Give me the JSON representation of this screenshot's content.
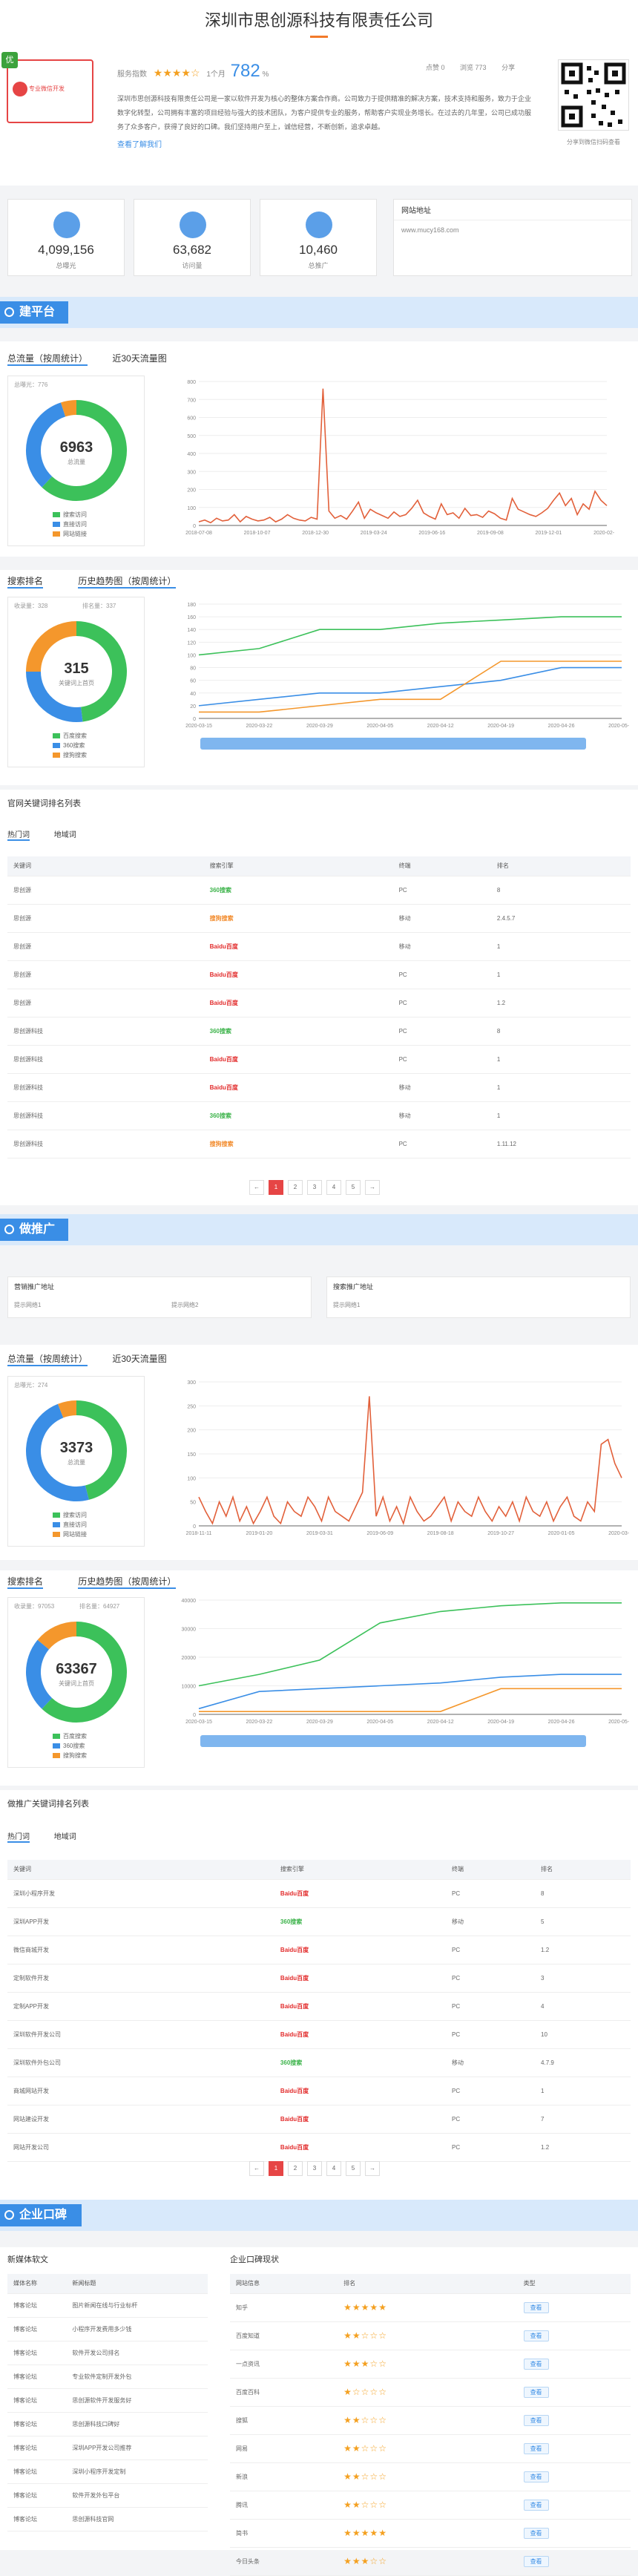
{
  "company": {
    "name": "深圳市思创源科技有限责任公司",
    "logo_badge": "优",
    "logo_text": "专业微信开发",
    "rating_label": "服务指数",
    "stars": "★★★★☆",
    "score_prefix": "1个月",
    "score": "782",
    "score_suffix": "%",
    "mini": [
      "点赞 0",
      "浏览 773",
      "分享"
    ],
    "description": "深圳市思创源科技有限责任公司是一家以软件开发为核心的整体方案合作商。公司致力于提供精准的解决方案，技术支持和服务，致力于企业数字化转型，公司拥有丰富的项目经验与强大的技术团队，为客户提供专业的服务，帮助客户实现业务增长。在过去的几年里，公司已成功服务了众多客户，获得了良好的口碑。我们坚持用户至上，诚信经营，不断创新，追求卓越。",
    "more_link": "查看了解我们",
    "qr_caption": "分享到微信扫码查看"
  },
  "stats": [
    {
      "value": "4,099,156",
      "label": "总曝光"
    },
    {
      "value": "63,682",
      "label": "访问量"
    },
    {
      "value": "10,460",
      "label": "总推广"
    }
  ],
  "website": {
    "title": "网站地址",
    "url": "www.mucy168.com"
  },
  "section1": {
    "band": "建平台",
    "tabs": [
      "总流量（按周统计）",
      "近30天流量图"
    ],
    "donut": {
      "head": "总曝光：776",
      "center": "6963",
      "sub": "总流量"
    },
    "legend": [
      "搜索访问",
      "直接访问",
      "网站链接"
    ],
    "rank_tabs": [
      "搜索排名",
      "历史趋势图（按周统计）"
    ],
    "rank_donut": {
      "head_left": "收录量：328",
      "head_right": "排名量：337",
      "center": "315",
      "sub": "关键词上首页"
    },
    "rank_legend": [
      "百度搜索",
      "360搜索",
      "搜狗搜索"
    ],
    "kw_title": "官网关键词排名列表",
    "kw_tabs": [
      "热门词",
      "地域词"
    ],
    "kw_headers": [
      "关键词",
      "搜索引擎",
      "终端",
      "排名"
    ],
    "kw_rows": [
      [
        "思创源",
        "360搜索",
        "PC",
        "8"
      ],
      [
        "思创源",
        "搜狗搜索",
        "移动",
        "2.4.5.7"
      ],
      [
        "思创源",
        "Baidu百度",
        "移动",
        "1"
      ],
      [
        "思创源",
        "Baidu百度",
        "PC",
        "1"
      ],
      [
        "思创源",
        "Baidu百度",
        "PC",
        "1.2"
      ],
      [
        "思创源科技",
        "360搜索",
        "PC",
        "8"
      ],
      [
        "思创源科技",
        "Baidu百度",
        "PC",
        "1"
      ],
      [
        "思创源科技",
        "Baidu百度",
        "移动",
        "1"
      ],
      [
        "思创源科技",
        "360搜索",
        "移动",
        "1"
      ],
      [
        "思创源科技",
        "搜狗搜索",
        "PC",
        "1.11.12"
      ]
    ],
    "pages": [
      "←",
      "1",
      "2",
      "3",
      "4",
      "5",
      "→"
    ]
  },
  "section2": {
    "band": "做推广",
    "box1": {
      "title": "营销推广地址",
      "items": [
        "提示网络1",
        "提示网络2"
      ]
    },
    "box2": {
      "title": "搜索推广地址",
      "items": [
        "提示网络1"
      ]
    },
    "tabs": [
      "总流量（按周统计）",
      "近30天流量图"
    ],
    "donut": {
      "head": "总曝光：274",
      "center": "3373",
      "sub": "总流量"
    },
    "legend": [
      "搜索访问",
      "直接访问",
      "网站链接"
    ],
    "rank_tabs": [
      "搜索排名",
      "历史趋势图（按周统计）"
    ],
    "rank_donut": {
      "head_left": "收录量：97053",
      "head_right": "排名量：64927",
      "center": "63367",
      "sub": "关键词上首页"
    },
    "rank_legend": [
      "百度搜索",
      "360搜索",
      "搜狗搜索"
    ],
    "kw_title": "做推广关键词排名列表",
    "kw_tabs": [
      "热门词",
      "地域词"
    ],
    "kw_headers": [
      "关键词",
      "搜索引擎",
      "终端",
      "排名"
    ],
    "kw_rows": [
      [
        "深圳小程序开发",
        "Baidu百度",
        "PC",
        "8"
      ],
      [
        "深圳APP开发",
        "360搜索",
        "移动",
        "5"
      ],
      [
        "微信商城开发",
        "Baidu百度",
        "PC",
        "1.2"
      ],
      [
        "定制软件开发",
        "Baidu百度",
        "PC",
        "3"
      ],
      [
        "定制APP开发",
        "Baidu百度",
        "PC",
        "4"
      ],
      [
        "深圳软件开发公司",
        "Baidu百度",
        "PC",
        "10"
      ],
      [
        "深圳软件外包公司",
        "360搜索",
        "移动",
        "4.7.9"
      ],
      [
        "商城网站开发",
        "Baidu百度",
        "PC",
        "1"
      ],
      [
        "网站建设开发",
        "Baidu百度",
        "PC",
        "7"
      ],
      [
        "网站开发公司",
        "Baidu百度",
        "PC",
        "1.2"
      ]
    ],
    "pages": [
      "←",
      "1",
      "2",
      "3",
      "4",
      "5",
      "→"
    ]
  },
  "section3": {
    "band": "企业口碑",
    "news_title": "新媒体软文",
    "news_headers": [
      "媒体名称",
      "新闻标题"
    ],
    "news_rows": [
      [
        "博客论坛",
        "图片新闻在线与行业标杆"
      ],
      [
        "博客论坛",
        "小程序开发费用多少钱"
      ],
      [
        "博客论坛",
        "软件开发公司排名"
      ],
      [
        "博客论坛",
        "专业软件定制开发外包"
      ],
      [
        "博客论坛",
        "思创源软件开发服务好"
      ],
      [
        "博客论坛",
        "思创源科技口碑好"
      ],
      [
        "博客论坛",
        "深圳APP开发公司推荐"
      ],
      [
        "博客论坛",
        "深圳小程序开发定制"
      ],
      [
        "博客论坛",
        "软件开发外包平台"
      ],
      [
        "博客论坛",
        "思创源科技官网"
      ]
    ],
    "rep_title": "企业口碑现状",
    "rep_headers": [
      "网站信息",
      "排名",
      "类型"
    ],
    "rep_rows": [
      [
        "知乎",
        "★★★★★",
        "查看"
      ],
      [
        "百度知道",
        "★★☆☆☆",
        "查看"
      ],
      [
        "一点资讯",
        "★★★☆☆",
        "查看"
      ],
      [
        "百度百科",
        "★☆☆☆☆",
        "查看"
      ],
      [
        "搜狐",
        "★★☆☆☆",
        "查看"
      ],
      [
        "网易",
        "★★☆☆☆",
        "查看"
      ],
      [
        "新浪",
        "★★☆☆☆",
        "查看"
      ],
      [
        "腾讯",
        "★★☆☆☆",
        "查看"
      ],
      [
        "简书",
        "★★★★★",
        "查看"
      ],
      [
        "今日头条",
        "★★★☆☆",
        "查看"
      ]
    ]
  },
  "charts": {
    "colors": {
      "green": "#3cc15a",
      "blue": "#3a8ee6",
      "orange": "#f4972c",
      "red": "#e2603a"
    },
    "donut1": [
      0.62,
      0.33,
      0.05
    ],
    "donut2": [
      0.48,
      0.27,
      0.25
    ],
    "donut3": [
      0.46,
      0.48,
      0.06
    ],
    "donut4": [
      0.62,
      0.24,
      0.14
    ]
  },
  "chart_data": [
    {
      "type": "line",
      "title": "",
      "x": [
        "2018-07-08",
        "2018-10-07",
        "2018-12-30",
        "2019-03-24",
        "2019-06-16",
        "2019-09-08",
        "2019-12-01",
        "2020-02-23"
      ],
      "ylim": [
        0,
        800
      ],
      "yticks": [
        0,
        100,
        200,
        300,
        400,
        500,
        600,
        700,
        800
      ],
      "series": [
        {
          "values": [
            20,
            30,
            15,
            40,
            25,
            30,
            60,
            20,
            50,
            35,
            25,
            30,
            45,
            20,
            35,
            60,
            40,
            30,
            25,
            45,
            35,
            760,
            80,
            40,
            55,
            35,
            80,
            130,
            40,
            90,
            70,
            55,
            40,
            75,
            50,
            60,
            95,
            140,
            70,
            50,
            35,
            120,
            60,
            70,
            40,
            95,
            55,
            60,
            45,
            80,
            65,
            40,
            30,
            150,
            90,
            75,
            60,
            50,
            70,
            95,
            140,
            180,
            110,
            150,
            60,
            120,
            90,
            190,
            140,
            110
          ]
        }
      ]
    },
    {
      "type": "line",
      "title": "",
      "x": [
        "2020-03-15",
        "2020-03-22",
        "2020-03-29",
        "2020-04-05",
        "2020-04-12",
        "2020-04-19",
        "2020-04-26",
        "2020-05-03"
      ],
      "ylim": [
        0,
        180
      ],
      "yticks": [
        0,
        20,
        40,
        60,
        80,
        100,
        120,
        140,
        160,
        180
      ],
      "series": [
        {
          "values": [
            100,
            110,
            140,
            140,
            150,
            155,
            160,
            160
          ]
        },
        {
          "values": [
            20,
            30,
            40,
            40,
            50,
            60,
            80,
            80
          ]
        },
        {
          "values": [
            10,
            10,
            20,
            30,
            30,
            90,
            90,
            90
          ]
        }
      ]
    },
    {
      "type": "line",
      "title": "",
      "x": [
        "2018-11-11",
        "2019-01-20",
        "2019-03-31",
        "2019-06-09",
        "2019-08-18",
        "2019-10-27",
        "2020-01-05",
        "2020-03-15"
      ],
      "ylim": [
        0,
        300
      ],
      "yticks": [
        0,
        50,
        100,
        150,
        200,
        250,
        300
      ],
      "series": [
        {
          "values": [
            60,
            30,
            5,
            50,
            20,
            60,
            10,
            40,
            5,
            30,
            60,
            20,
            5,
            50,
            30,
            20,
            60,
            40,
            10,
            60,
            30,
            20,
            10,
            40,
            70,
            270,
            20,
            60,
            10,
            40,
            5,
            60,
            30,
            10,
            20,
            40,
            60,
            10,
            50,
            30,
            20,
            60,
            30,
            10,
            40,
            20,
            50,
            10,
            60,
            30,
            20,
            50,
            10,
            40,
            60,
            20,
            10,
            50,
            30,
            170,
            180,
            130,
            100
          ]
        }
      ]
    },
    {
      "type": "line",
      "title": "",
      "x": [
        "2020-03-15",
        "2020-03-22",
        "2020-03-29",
        "2020-04-05",
        "2020-04-12",
        "2020-04-19",
        "2020-04-26",
        "2020-05-03"
      ],
      "ylim": [
        0,
        40000
      ],
      "yticks": [
        0,
        10000,
        20000,
        30000,
        40000
      ],
      "series": [
        {
          "values": [
            10000,
            14000,
            19000,
            32000,
            36000,
            38000,
            39000,
            39000
          ]
        },
        {
          "values": [
            2000,
            8000,
            9000,
            10000,
            11000,
            13000,
            14000,
            14000
          ]
        },
        {
          "values": [
            1000,
            1000,
            1000,
            1000,
            1000,
            9000,
            9000,
            9000
          ]
        }
      ]
    }
  ]
}
